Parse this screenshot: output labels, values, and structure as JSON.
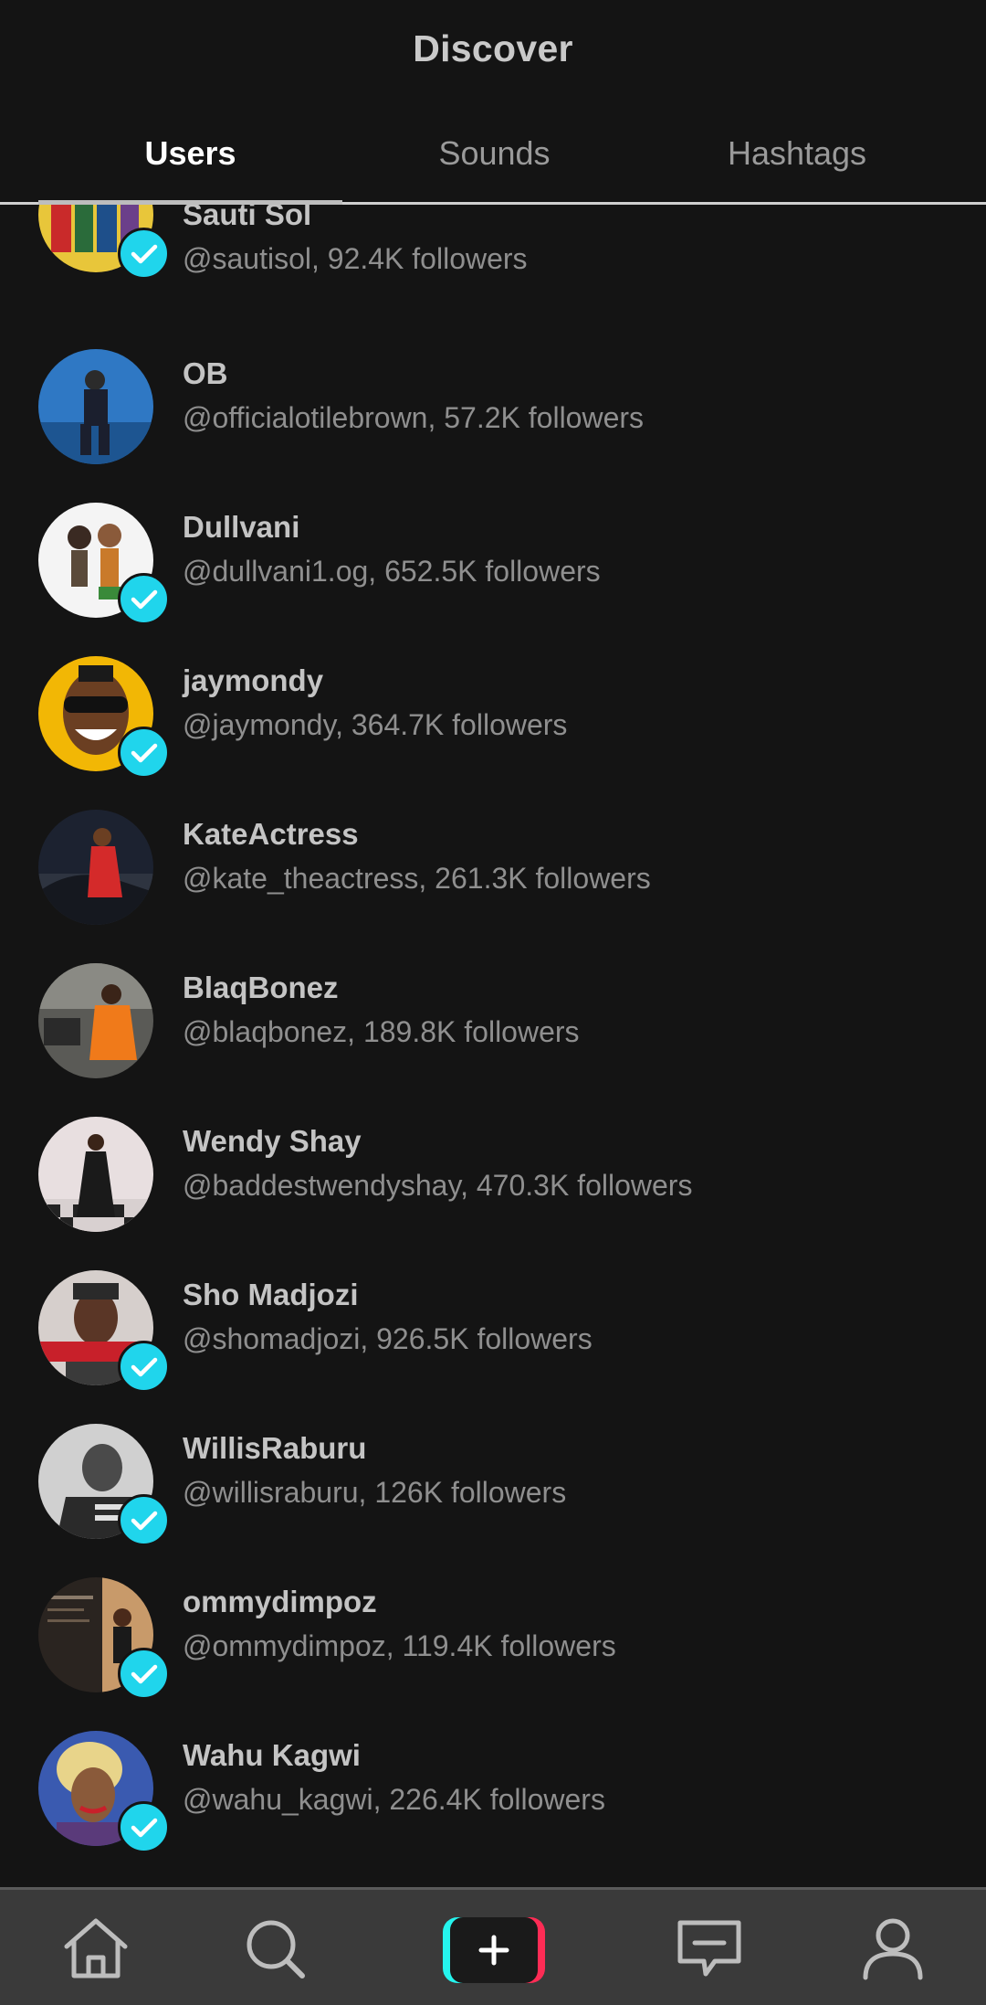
{
  "header": {
    "title": "Discover"
  },
  "tabs": [
    {
      "label": "Users",
      "active": true
    },
    {
      "label": "Sounds",
      "active": false
    },
    {
      "label": "Hashtags",
      "active": false
    }
  ],
  "users": [
    {
      "name": "Sauti Sol",
      "meta": "@sautisol, 92.4K followers",
      "verified": true
    },
    {
      "name": "OB",
      "meta": "@officialotilebrown, 57.2K followers",
      "verified": false
    },
    {
      "name": "Dullvani",
      "meta": "@dullvani1.og, 652.5K followers",
      "verified": true
    },
    {
      "name": "jaymondy",
      "meta": "@jaymondy, 364.7K followers",
      "verified": true
    },
    {
      "name": "KateActress",
      "meta": "@kate_theactress, 261.3K followers",
      "verified": false
    },
    {
      "name": "BlaqBonez",
      "meta": "@blaqbonez, 189.8K followers",
      "verified": false
    },
    {
      "name": "Wendy Shay",
      "meta": "@baddestwendyshay, 470.3K followers",
      "verified": false
    },
    {
      "name": "Sho Madjozi",
      "meta": "@shomadjozi, 926.5K followers",
      "verified": true
    },
    {
      "name": "WillisRaburu",
      "meta": "@willisraburu, 126K followers",
      "verified": true
    },
    {
      "name": "ommydimpoz",
      "meta": "@ommydimpoz, 119.4K followers",
      "verified": true
    },
    {
      "name": "Wahu Kagwi",
      "meta": "@wahu_kagwi, 226.4K followers",
      "verified": true
    }
  ],
  "bottom_nav": [
    {
      "icon": "home-icon"
    },
    {
      "icon": "search-icon"
    },
    {
      "icon": "create-icon"
    },
    {
      "icon": "inbox-icon"
    },
    {
      "icon": "profile-icon"
    }
  ],
  "colors": {
    "background": "#141414",
    "verified_badge": "#20d5ec",
    "bottom_bar": "#3a3a3a",
    "accent_cyan": "#25f4ee",
    "accent_red": "#fe2c55"
  }
}
